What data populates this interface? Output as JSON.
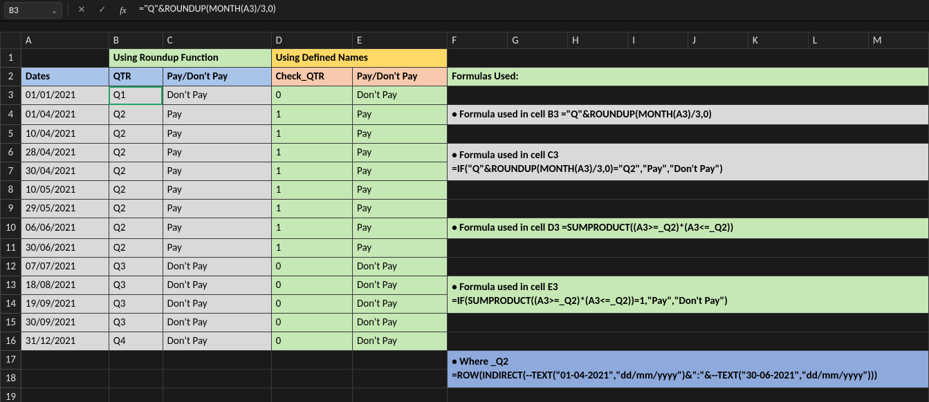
{
  "name_box": "B3",
  "formula": "=\"Q\"&ROUNDUP(MONTH(A3)/3,0)",
  "icons": {
    "cancel": "✕",
    "confirm": "✓",
    "fx": "fx",
    "chevron": "⌄"
  },
  "columns": [
    "A",
    "B",
    "C",
    "D",
    "E",
    "F",
    "G",
    "H",
    "I",
    "J",
    "K",
    "L",
    "M"
  ],
  "row_count": 19,
  "headers": {
    "roundup_title": "Using Roundup Function",
    "defined_title": "Using Defined Names",
    "dates": "Dates",
    "qtr": "QTR",
    "paydont": "Pay/Don't Pay",
    "check_qtr": "Check_QTR",
    "paydont2": "Pay/Don't Pay",
    "formulas_used": "Formulas Used:"
  },
  "rows": [
    {
      "date": "01/01/2021",
      "qtr": "Q1",
      "pay1": "Don't Pay",
      "chk": "0",
      "pay2": "Don't Pay"
    },
    {
      "date": "01/04/2021",
      "qtr": "Q2",
      "pay1": "Pay",
      "chk": "1",
      "pay2": "Pay"
    },
    {
      "date": "10/04/2021",
      "qtr": "Q2",
      "pay1": "Pay",
      "chk": "1",
      "pay2": "Pay"
    },
    {
      "date": "28/04/2021",
      "qtr": "Q2",
      "pay1": "Pay",
      "chk": "1",
      "pay2": "Pay"
    },
    {
      "date": "30/04/2021",
      "qtr": "Q2",
      "pay1": "Pay",
      "chk": "1",
      "pay2": "Pay"
    },
    {
      "date": "10/05/2021",
      "qtr": "Q2",
      "pay1": "Pay",
      "chk": "1",
      "pay2": "Pay"
    },
    {
      "date": "29/05/2021",
      "qtr": "Q2",
      "pay1": "Pay",
      "chk": "1",
      "pay2": "Pay"
    },
    {
      "date": "06/06/2021",
      "qtr": "Q2",
      "pay1": "Pay",
      "chk": "1",
      "pay2": "Pay"
    },
    {
      "date": "30/06/2021",
      "qtr": "Q2",
      "pay1": "Pay",
      "chk": "1",
      "pay2": "Pay"
    },
    {
      "date": "07/07/2021",
      "qtr": "Q3",
      "pay1": "Don't Pay",
      "chk": "0",
      "pay2": "Don't Pay"
    },
    {
      "date": "18/08/2021",
      "qtr": "Q3",
      "pay1": "Don't Pay",
      "chk": "0",
      "pay2": "Don't Pay"
    },
    {
      "date": "19/09/2021",
      "qtr": "Q3",
      "pay1": "Don't Pay",
      "chk": "0",
      "pay2": "Don't Pay"
    },
    {
      "date": "30/09/2021",
      "qtr": "Q3",
      "pay1": "Don't Pay",
      "chk": "0",
      "pay2": "Don't Pay"
    },
    {
      "date": "31/12/2021",
      "qtr": "Q4",
      "pay1": "Don't Pay",
      "chk": "0",
      "pay2": "Don't Pay"
    }
  ],
  "notes": {
    "n1": "• Formula used in cell B3 =\"Q\"&ROUNDUP(MONTH(A3)/3,0)",
    "n2a": "• Formula used in cell C3",
    "n2b": "=IF(\"Q\"&ROUNDUP(MONTH(A3)/3,0)=\"Q2\",\"Pay\",\"Don't Pay\")",
    "n3": "• Formula used in cell D3 =SUMPRODUCT((A3>=_Q2)*(A3<=_Q2))",
    "n4a": "• Formula used in cell E3",
    "n4b": "=IF(SUMPRODUCT((A3>=_Q2)*(A3<=_Q2))=1,\"Pay\",\"Don't Pay\")",
    "n5a": "• Where _Q2",
    "n5b": "=ROW(INDIRECT(--TEXT(\"01-04-2021\",\"dd/mm/yyyy\")&\":\"&--TEXT(\"30-06-2021\",\"dd/mm/yyyy\")))"
  }
}
